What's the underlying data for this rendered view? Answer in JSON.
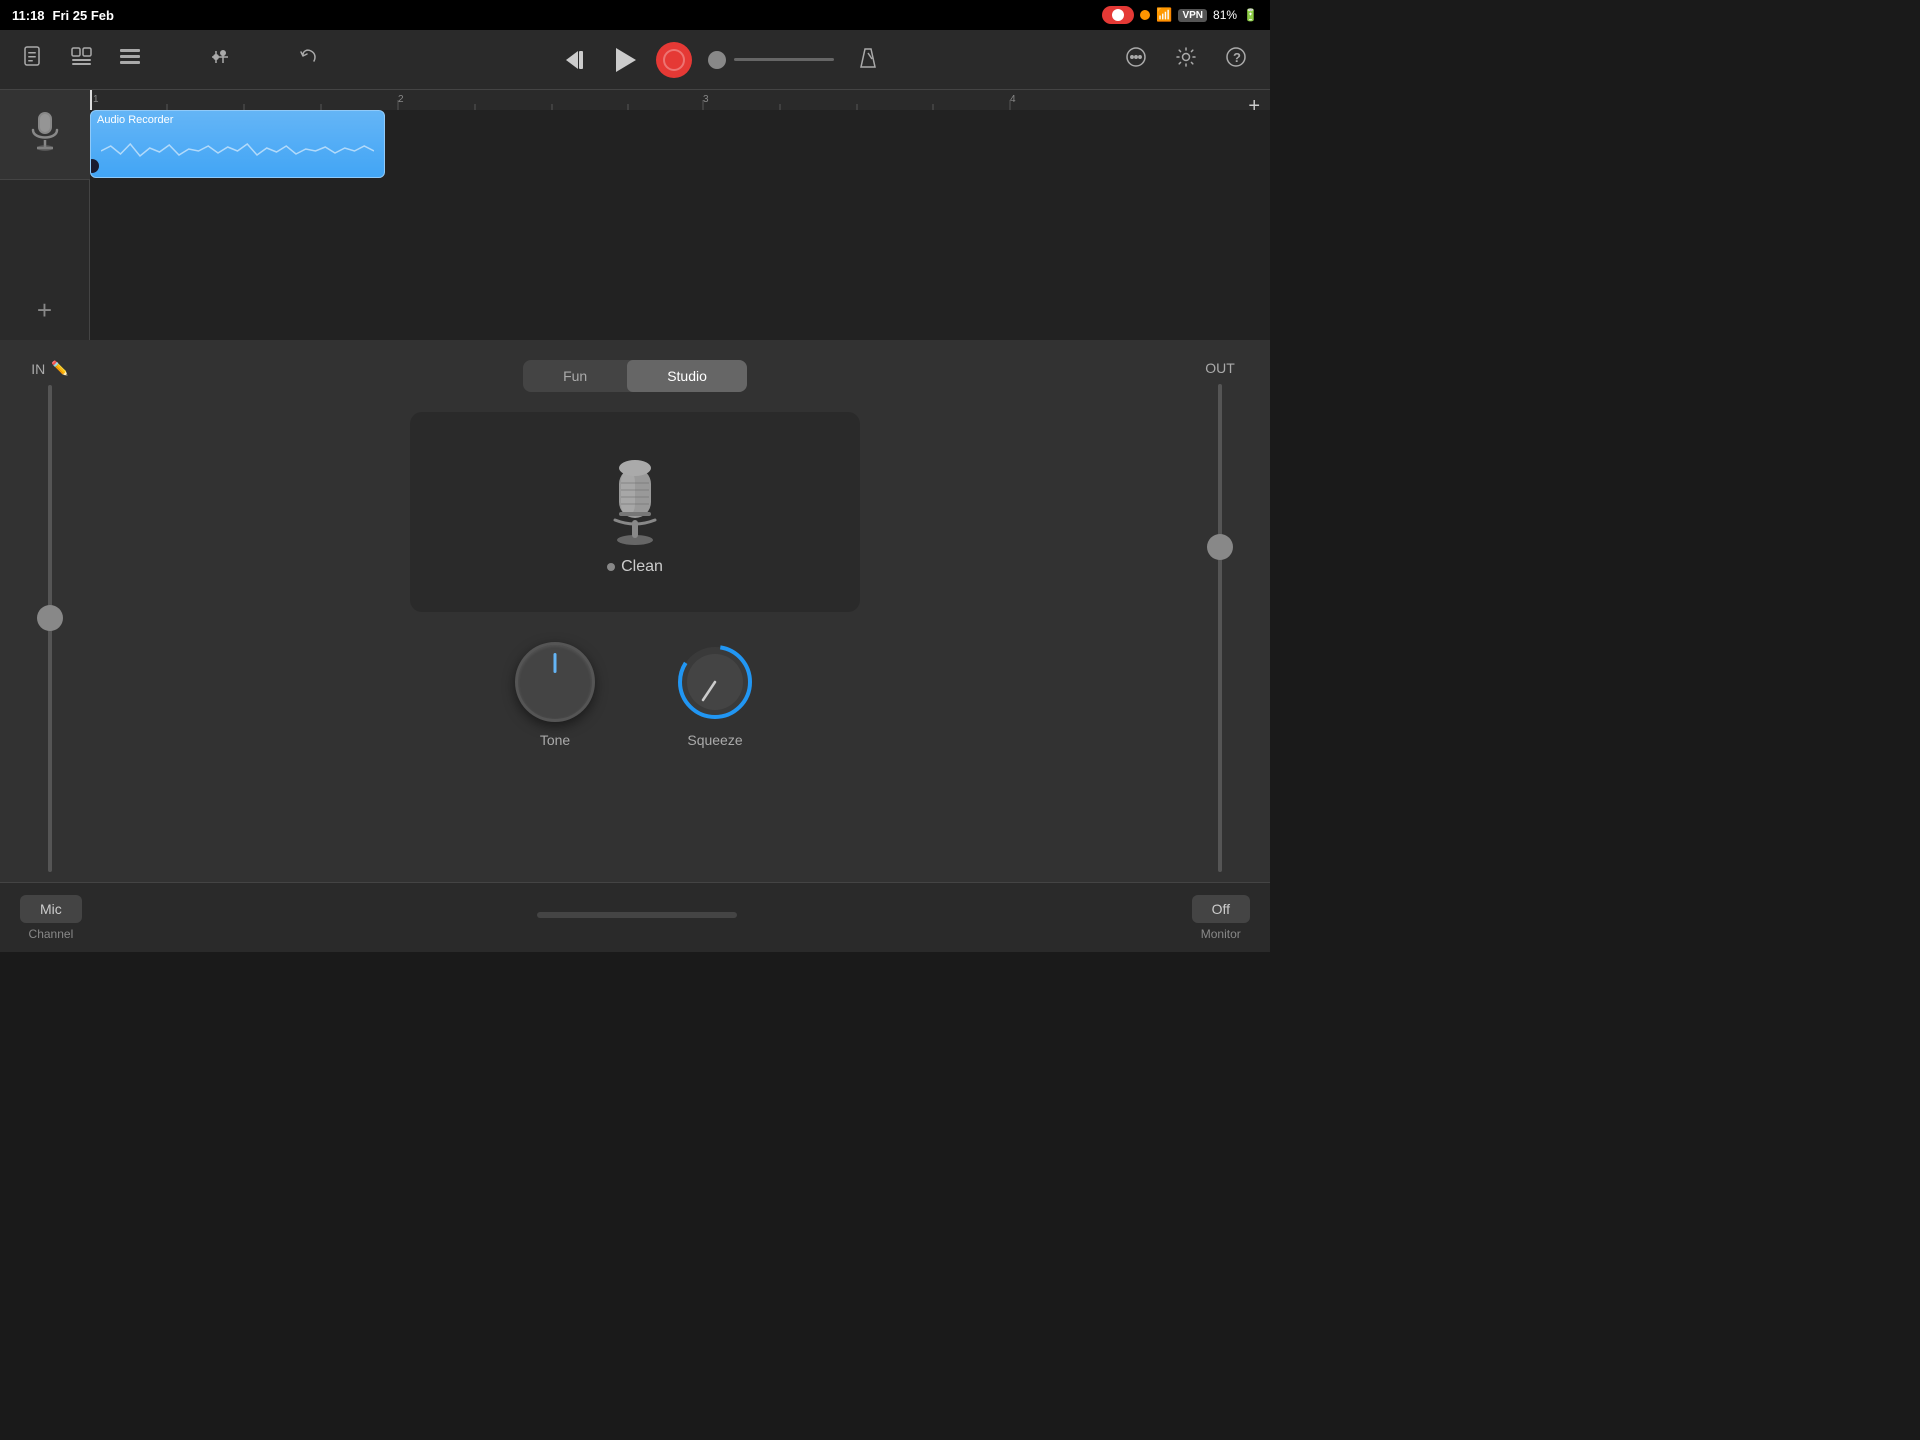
{
  "statusBar": {
    "time": "11:18",
    "date": "Fri 25 Feb",
    "battery": "81%"
  },
  "toolbar": {
    "rewindLabel": "⏮",
    "playLabel": "▶",
    "undoLabel": "↩"
  },
  "track": {
    "clipTitle": "Audio Recorder",
    "timelineAddLabel": "+"
  },
  "instrumentPanel": {
    "inLabel": "IN",
    "outLabel": "OUT",
    "funTabLabel": "Fun",
    "studioTabLabel": "Studio",
    "activeTab": "Studio",
    "micLabel": "Clean",
    "toneKnobLabel": "Tone",
    "squeezeKnobLabel": "Squeeze",
    "bottomLeftBtnLabel": "Mic",
    "bottomLeftChannelLabel": "Channel",
    "bottomRightBtnLabel": "Off",
    "bottomRightMonitorLabel": "Monitor"
  }
}
